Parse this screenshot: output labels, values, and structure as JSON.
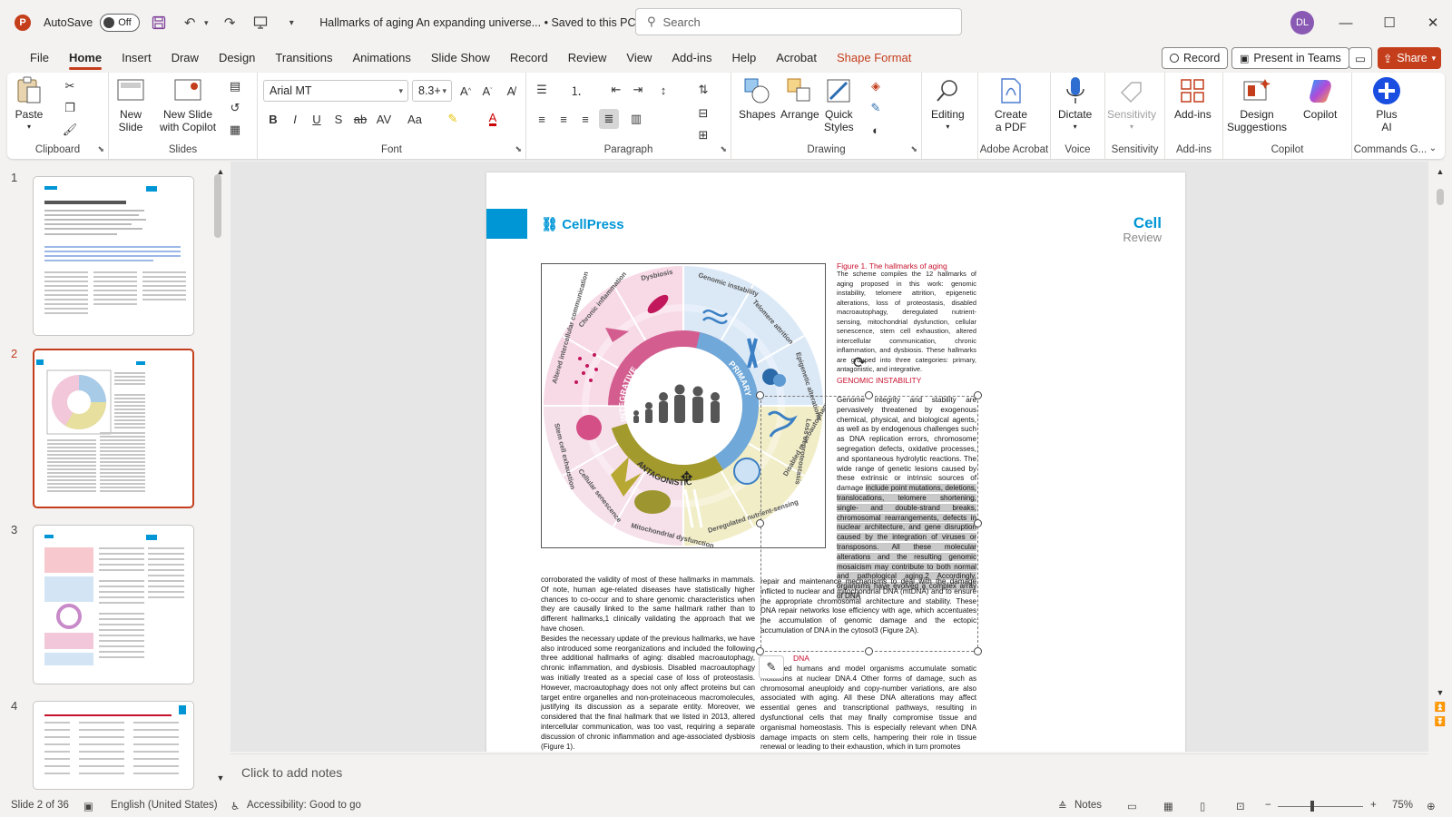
{
  "titlebar": {
    "app_letter": "P",
    "autosave_label": "AutoSave",
    "autosave_state": "Off",
    "doc_title": "Hallmarks of aging An expanding universe...",
    "save_status": "• Saved to this PC",
    "search_placeholder": "Search",
    "user_initials": "DL"
  },
  "menu": {
    "tabs": [
      "File",
      "Home",
      "Insert",
      "Draw",
      "Design",
      "Transitions",
      "Animations",
      "Slide Show",
      "Record",
      "Review",
      "View",
      "Add-ins",
      "Help",
      "Acrobat",
      "Shape Format"
    ],
    "active": "Home",
    "record_label": "Record",
    "present_label": "Present in Teams",
    "share_label": "Share"
  },
  "ribbon": {
    "clipboard": {
      "label": "Clipboard",
      "paste": "Paste"
    },
    "slides": {
      "label": "Slides",
      "new_slide": "New\nSlide",
      "new_slide_copilot": "New Slide\nwith Copilot"
    },
    "font": {
      "label": "Font",
      "font_name": "Arial MT",
      "font_size": "8.3+"
    },
    "paragraph": {
      "label": "Paragraph"
    },
    "drawing": {
      "label": "Drawing",
      "shapes": "Shapes",
      "arrange": "Arrange",
      "quick_styles": "Quick\nStyles"
    },
    "editing": {
      "label": "Editing"
    },
    "acrobat": {
      "label": "Adobe Acrobat",
      "create_pdf": "Create\na PDF"
    },
    "voice": {
      "label": "Voice",
      "dictate": "Dictate"
    },
    "sensitivity": {
      "label": "Sensitivity",
      "btn": "Sensitivity"
    },
    "addins": {
      "label": "Add-ins",
      "btn": "Add-ins"
    },
    "copilot": {
      "label": "Copilot",
      "design": "Design\nSuggestions",
      "copilot": "Copilot"
    },
    "commands": {
      "label": "Commands G...",
      "plus": "Plus\nAI"
    }
  },
  "thumbnails": {
    "numbers": [
      "1",
      "2",
      "3",
      "4"
    ],
    "active": "2"
  },
  "slide": {
    "cellpress": "CellPress",
    "cell": "Cell",
    "review": "Review",
    "figure_title": "Figure 1.  The hallmarks of aging",
    "figure_caption": "The scheme compiles the 12 hallmarks of aging proposed in this work: genomic instability, telomere attrition, epigenetic alterations, loss of proteostasis, disabled macroautophagy, deregulated nutrient-sensing, mitochondrial dysfunction, cellular senescence, stem cell exhaustion, altered intercellular communication, chronic inflammation, and dysbiosis. These hallmarks are grouped into three categories: primary, antagonistic, and integrative.",
    "section_head": "GENOMIC INSTABILITY",
    "wheel_labels": {
      "integrative": "INTEGRATIVE",
      "primary": "PRIMARY",
      "antagonistic": "ANTAGONISTIC",
      "dysbiosis": "Dysbiosis",
      "genomic": "Genomic instability",
      "telomere": "Telomere attrition",
      "epigenetic": "Epigenetic alterations",
      "proteostasis": "Loss of proteostasis",
      "macroautophagy": "Disabled macroautophagy",
      "nutrient": "Deregulated nutrient-sensing",
      "mito": "Mitochondrial dysfunction",
      "senescence": "Cellular senescence",
      "stem": "Stem cell exhaustion",
      "intercellular": "Altered intercellular communication",
      "inflammation": "Chronic inflammation"
    },
    "right_col_a": "Genome integrity and stability are pervasively threatened by exogenous chemical, physical, and biological agents, as well as by endogenous challenges such as DNA replication errors, chromosome segregation defects, oxidative processes, and spontaneous hydrolytic reactions. The wide range of genetic lesions caused by these extrinsic or intrinsic sources of damage ",
    "right_col_hl": "include point mutations, deletions, translocations, telomere shortening, single- and double-strand breaks, chromosomal rearrangements, defects in nuclear architecture, and gene disruption caused by the integration of viruses or transposons. All these molecular alterations and the resulting genomic mosaicism may contribute to both normal and pathological aging.2 Accordingly, organisms have evolved a complex array of DNA",
    "right_col_b": " repair and maintenance mechanisms to deal with the damage inflicted to nuclear and mitochondrial DNA (mtDNA) and to ensure the appropriate chromosomal architecture and stability. These DNA repair networks lose efficiency with age, which accentuates the accumulation of genomic damage and the ectopic accumulation of DNA in the cytosol3 (Figure 2A).",
    "dna_head": "DNA",
    "right_col_c": "om aged humans and model organisms accumulate somatic mutations at nuclear DNA.4 Other forms of damage, such as chromosomal aneuploidy and copy-number variations, are also associated with aging. All these DNA alterations may affect essential genes and transcriptional pathways, resulting in dysfunctional cells that may finally compromise tissue and organismal homeostasis. This is especially relevant when DNA damage impacts on stem cells, hampering their role in tissue renewal or leading to their exhaustion, which in turn promotes",
    "left_col": "corroborated the validity of most of these hallmarks in mammals. Of note, human age-related diseases have statistically higher chances to co-occur and to share genomic characteristics when they are causally linked to the same hallmark rather than to different hallmarks,1 clinically validating the approach that we have chosen.\n    Besides the necessary update of the previous hallmarks, we have also introduced some reorganizations and included the following three additional hallmarks of aging: disabled macroautophagy, chronic inflammation, and dysbiosis. Disabled macroautophagy was initially treated as a special case of loss of proteostasis. However, macroautophagy does not only affect proteins but can target entire organelles and non-proteinaceous macromolecules, justifying its discussion as a separate entity. Moreover, we considered that the final hallmark that we listed in 2013, altered intercellular communication, was too vast, requiring a separate discussion of chronic inflammation and age-associated dysbiosis (Figure 1)."
  },
  "notes": {
    "placeholder": "Click to add notes"
  },
  "status": {
    "slide_count": "Slide 2 of 36",
    "language": "English (United States)",
    "accessibility": "Accessibility: Good to go",
    "notes": "Notes",
    "zoom": "75%"
  },
  "colors": {
    "accent": "#c43e1c",
    "cell_blue": "#0096d6"
  }
}
